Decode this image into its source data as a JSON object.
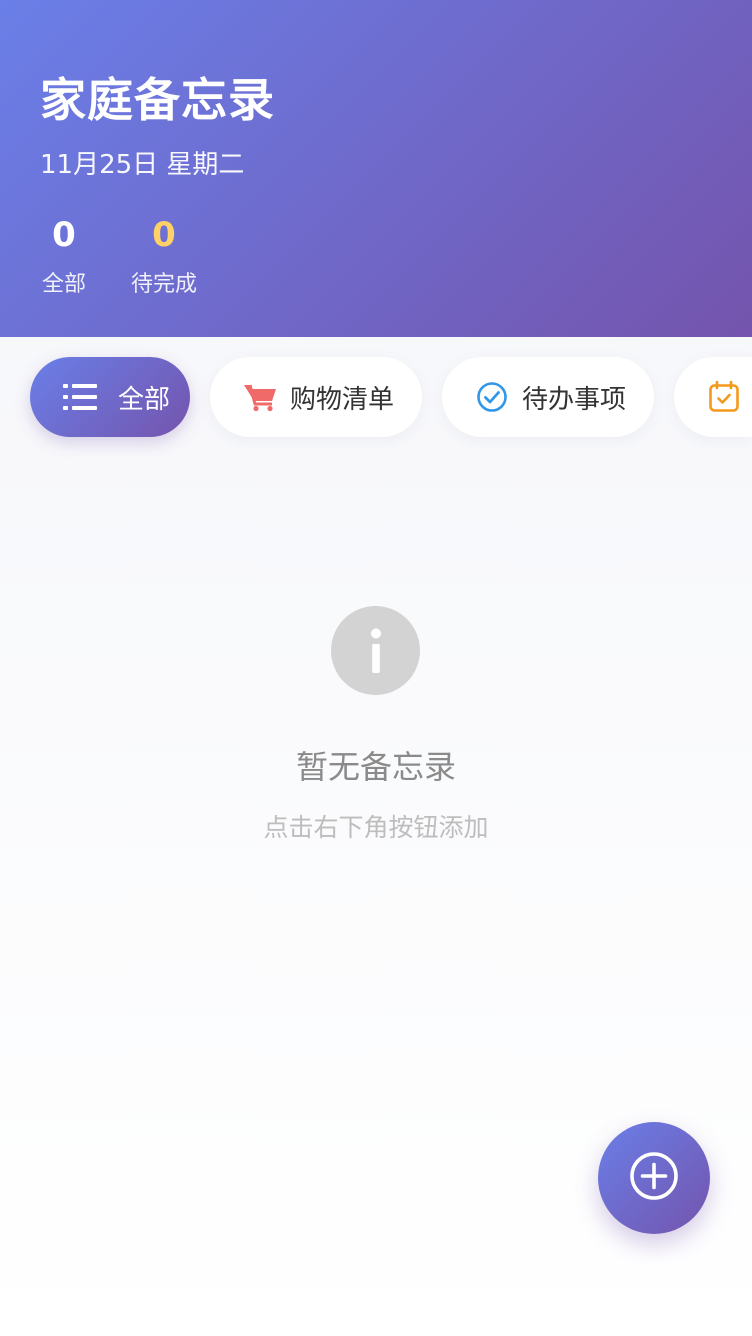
{
  "header": {
    "title": "家庭备忘录",
    "date": "11月25日 星期二",
    "stats": {
      "all": {
        "value": "0",
        "label": "全部"
      },
      "pending": {
        "value": "0",
        "label": "待完成"
      }
    }
  },
  "tabs": [
    {
      "label": "全部",
      "icon": "list-icon",
      "active": true
    },
    {
      "label": "购物清单",
      "icon": "cart-icon",
      "color": "#f06a6a"
    },
    {
      "label": "待办事项",
      "icon": "check-circle-icon",
      "color": "#3296e8"
    },
    {
      "label": "",
      "icon": "calendar-icon",
      "color": "#f39a1c"
    }
  ],
  "empty": {
    "icon": "info-icon",
    "title": "暂无备忘录",
    "subtitle": "点击右下角按钮添加"
  },
  "fab": {
    "icon": "plus-circle-icon"
  },
  "colors": {
    "gradient_start": "#6a7fe8",
    "gradient_end": "#7454ad",
    "pending_accent": "#ffd166"
  }
}
